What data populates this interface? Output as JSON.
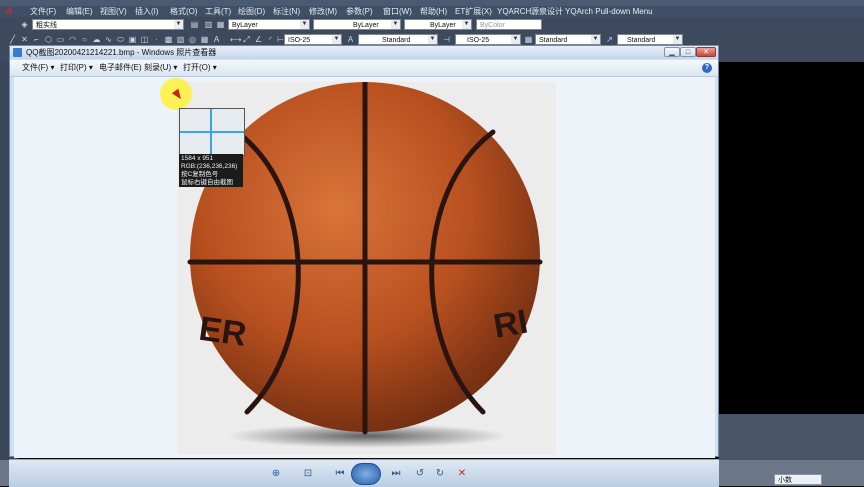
{
  "cad": {
    "menu": [
      "文件(F)",
      "编辑(E)",
      "视图(V)",
      "插入(I)",
      "格式(O)",
      "工具(T)",
      "绘图(D)",
      "标注(N)",
      "修改(M)",
      "参数(P)",
      "窗口(W)",
      "帮助(H)",
      "ET扩展(X)",
      "YQARCH",
      "源泉设计",
      "YQArch Pull-down Menu"
    ],
    "layer_combo": "粗实线",
    "color_combo": "ByLayer",
    "linetype_combo": "ByLayer",
    "lineweight_combo": "ByLayer",
    "plotstyle_combo": "ByColor",
    "dim_style_1": "ISO-25",
    "text_style": "Standard",
    "dim_style_2": "ISO-25",
    "table_style": "Standard",
    "multileader_style": "Standard",
    "status_combo": "小数"
  },
  "viewer": {
    "title": "QQ截图20200421214221.bmp - Windows 照片查看器",
    "menu": {
      "file": "文件(F)",
      "print": "打印(P)",
      "email": "电子邮件(E)",
      "burn": "刻录(U)",
      "open": "打开(O)"
    },
    "help": "?"
  },
  "magnifier": {
    "size": "1584 x 951",
    "rgb": "RGB:(236,236,236)",
    "hint1": "按C复制色号",
    "hint2": "鼠标右键自由截图"
  },
  "photo": {
    "ball_text_left": "ER",
    "ball_text_right": "RI"
  },
  "colors": {
    "ball": "#b8501f",
    "seam": "#2a1410",
    "bg": "#ececec",
    "window_frame": "#cfe0f2"
  }
}
